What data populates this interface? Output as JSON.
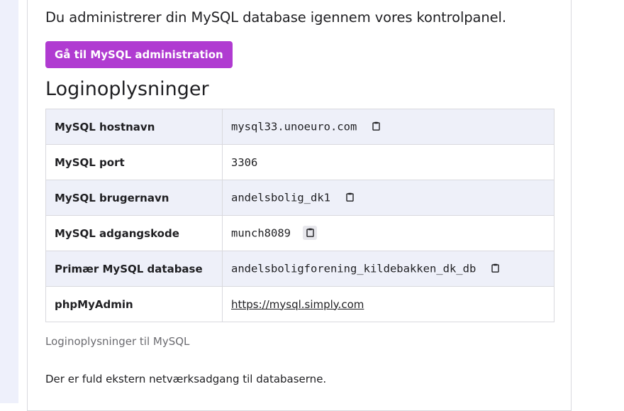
{
  "intro_text": "Du administrerer din MySQL database igennem vores kontrolpanel.",
  "admin_button_label": "Gå til MySQL administration",
  "section_title": "Loginoplysninger",
  "rows": [
    {
      "label": "MySQL hostnavn",
      "value": "mysql33.unoeuro.com",
      "copy_icon": "clipboard-icon"
    },
    {
      "label": "MySQL port",
      "value": "3306"
    },
    {
      "label": "MySQL brugernavn",
      "value": "andelsbolig_dk1",
      "copy_icon": "clipboard-icon"
    },
    {
      "label": "MySQL adgangskode",
      "value": "munch8089",
      "copy_icon": "clipboard-icon"
    },
    {
      "label": "Primær MySQL database",
      "value": "andelsboligforening_kildebakken_dk_db",
      "copy_icon": "clipboard-icon"
    },
    {
      "label": "phpMyAdmin",
      "value": "https://mysql.simply.com"
    }
  ],
  "table_caption": "Loginoplysninger til MySQL",
  "network_note": "Der er fuld ekstern netværksadgang til databaserne.",
  "colors": {
    "accent_button": "#b03bd1",
    "row_alt_bg": "#eef0f9",
    "border": "#d9d9de",
    "left_strip": "#eef0fb"
  }
}
